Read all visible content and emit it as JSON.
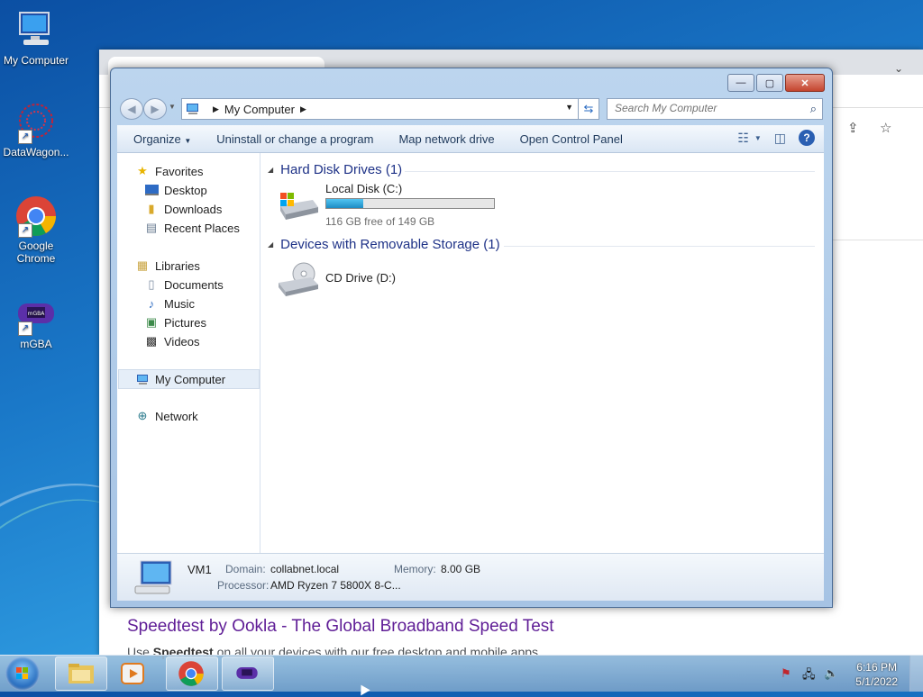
{
  "desktop": {
    "icons": [
      {
        "label": "My Computer"
      },
      {
        "label": "DataWagon..."
      },
      {
        "label": "Google Chrome"
      },
      {
        "label": "mGBA"
      }
    ]
  },
  "browser": {
    "result_title": "Speedtest by Ookla - The Global Broadband Speed Test",
    "result_desc_prefix": "Use ",
    "result_desc_bold": "Speedtest",
    "result_desc_suffix": " on all your devices with our free desktop and mobile apps"
  },
  "explorer": {
    "title": "My Computer",
    "address_path": "My Computer",
    "search_placeholder": "Search My Computer",
    "commands": [
      "Organize",
      "Uninstall or change a program",
      "Map network drive",
      "Open Control Panel"
    ],
    "nav": {
      "favorites": "Favorites",
      "desktop": "Desktop",
      "downloads": "Downloads",
      "recent": "Recent Places",
      "libraries": "Libraries",
      "documents": "Documents",
      "music": "Music",
      "pictures": "Pictures",
      "videos": "Videos",
      "computer": "My Computer",
      "network": "Network"
    },
    "groups": {
      "hdd": "Hard Disk Drives (1)",
      "removable": "Devices with Removable Storage (1)"
    },
    "drives": {
      "c_name": "Local Disk (C:)",
      "c_free": "116 GB free of 149 GB",
      "c_used_fraction": 0.22,
      "d_name": "CD Drive (D:)"
    },
    "details": {
      "name": "VM1",
      "domain_label": "Domain:",
      "domain": "collabnet.local",
      "memory_label": "Memory:",
      "memory": "8.00 GB",
      "processor_label": "Processor:",
      "processor": "AMD Ryzen 7 5800X 8-C..."
    }
  },
  "taskbar": {
    "time": "6:16 PM",
    "date": "5/1/2022"
  },
  "colors": {
    "accent": "#1e3287",
    "link_visited": "#5f1d96"
  }
}
